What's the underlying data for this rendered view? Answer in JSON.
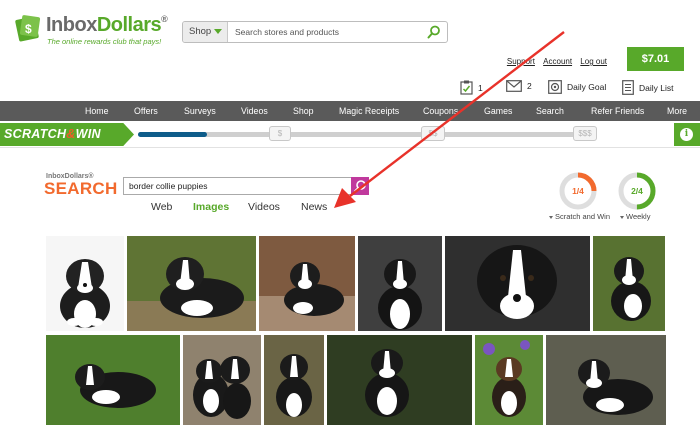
{
  "logo": {
    "brand_a": "Inbox",
    "brand_b": "Dollars",
    "reg": "®",
    "tagline": "The online rewards club that pays!"
  },
  "shop": {
    "select_value": "Shop",
    "placeholder": "Search stores and products"
  },
  "account_links": [
    "Support",
    "Account",
    "Log out"
  ],
  "balance": "$7.01",
  "stats": [
    {
      "icon": "clipboard-check-icon",
      "value": "1"
    },
    {
      "icon": "envelope-icon",
      "value": "2"
    },
    {
      "icon": "daily-goal-icon",
      "value": "Daily Goal"
    },
    {
      "icon": "daily-list-icon",
      "value": "Daily List"
    }
  ],
  "nav": [
    "Home",
    "Offers",
    "Surveys",
    "Videos",
    "Shop",
    "Magic Receipts",
    "Coupons",
    "Games",
    "Search",
    "Refer Friends",
    "More"
  ],
  "scratch": {
    "title_a": "SCRATCH",
    "amp": "&",
    "title_b": "WIN",
    "progress": 0.15,
    "markers": [
      "$",
      "$$",
      "$$$"
    ],
    "info": "i"
  },
  "search": {
    "logo_small": "InboxDollars®",
    "logo_big": "SEARCH",
    "query": "border collie puppies",
    "tabs": [
      "Web",
      "Images",
      "Videos",
      "News"
    ],
    "active_tab": "Images"
  },
  "goals": [
    {
      "value": "1/4",
      "label": "Scratch and Win",
      "fraction": 0.25,
      "color": "#f26a2e"
    },
    {
      "value": "2/4",
      "label": "Weekly",
      "fraction": 0.5,
      "color": "#58a92a"
    }
  ],
  "colors": {
    "brand_green": "#58a92a",
    "nav_gray": "#5a5a5a",
    "search_orange": "#f26a2e",
    "search_button": "#c0399d",
    "progress_blue": "#0e5c8a",
    "annotation_red": "#e8322a"
  }
}
